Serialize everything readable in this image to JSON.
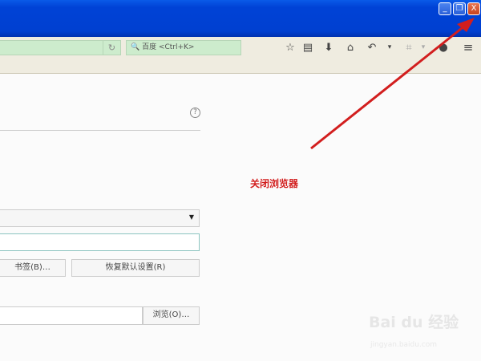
{
  "window": {
    "minimize": "_",
    "restore": "❐",
    "close": "X"
  },
  "toolbar": {
    "reload_icon": "reload-icon",
    "search_placeholder": "🔍 百度 <Ctrl+K>",
    "icons": [
      "☆",
      "▤",
      "⬇",
      "⌂",
      "↶",
      "▾",
      "⌗",
      "▾",
      "●",
      "≡"
    ]
  },
  "settings": {
    "help": "?",
    "bookmarks_button": "书签(B)…",
    "restore_defaults_button": "恢复默认设置(R)",
    "browse_button": "浏览(O)…"
  },
  "annotation": {
    "text": "关闭浏览器",
    "color": "#d21e1e"
  },
  "watermark": {
    "brand": "Bai du 经验",
    "url": "jingyan.baidu.com"
  }
}
